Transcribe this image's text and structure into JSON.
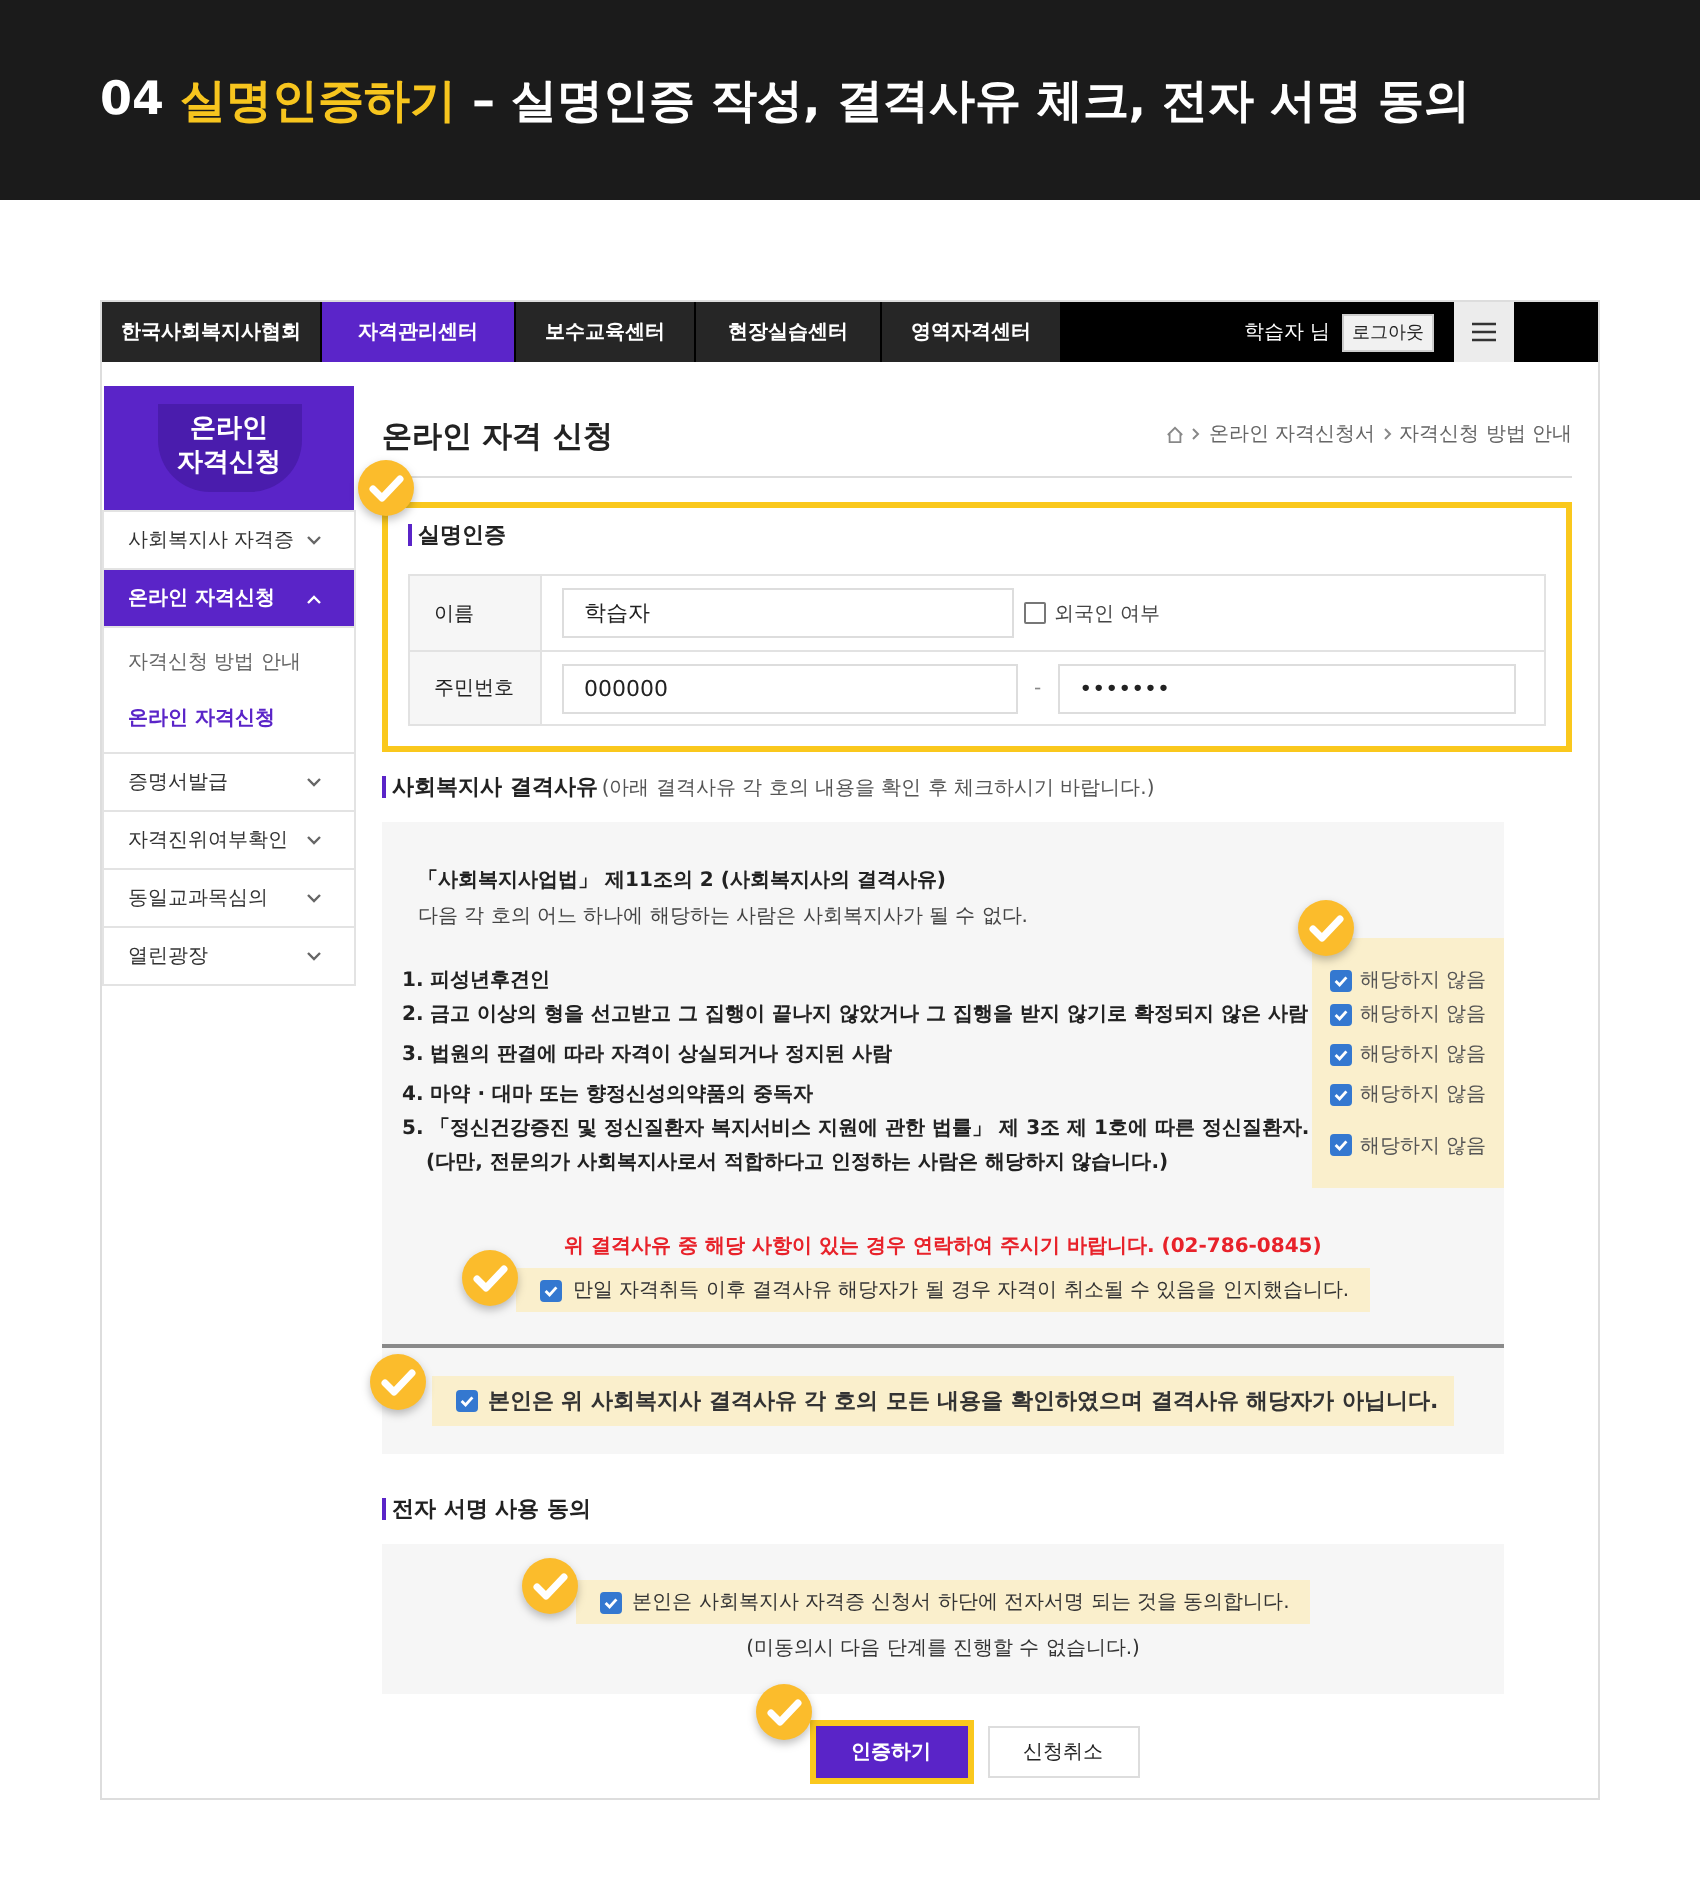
{
  "banner": {
    "number": "04",
    "highlight": "실명인증하기",
    "rest": "– 실명인증 작성, 결격사유 체크, 전자 서명 동의"
  },
  "nav": {
    "tabs": [
      {
        "label": "한국사회복지사협회",
        "selected": false
      },
      {
        "label": "자격관리센터",
        "selected": true
      },
      {
        "label": "보수교육센터",
        "selected": false
      },
      {
        "label": "현장실습센터",
        "selected": false
      },
      {
        "label": "영역자격센터",
        "selected": false
      }
    ],
    "user": "학습자 님",
    "logout": "로그아웃"
  },
  "sidebar": {
    "title": "온라인 자격신청",
    "items": [
      {
        "label": "사회복지사 자격증",
        "expanded": false
      },
      {
        "label": "온라인 자격신청",
        "expanded": true,
        "children": [
          {
            "label": "자격신청 방법 안내",
            "selected": false
          },
          {
            "label": "온라인 자격신청",
            "selected": true
          }
        ]
      },
      {
        "label": "증명서발급",
        "expanded": false
      },
      {
        "label": "자격진위여부확인",
        "expanded": false
      },
      {
        "label": "동일교과목심의",
        "expanded": false
      },
      {
        "label": "열린광장",
        "expanded": false
      }
    ]
  },
  "page": {
    "title": "온라인 자격 신청",
    "breadcrumb": [
      "온라인 자격신청서",
      "자격신청 방법 안내"
    ]
  },
  "identity": {
    "heading": "실명인증",
    "name_label": "이름",
    "name_value": "학습자",
    "foreigner": {
      "label": "외국인 여부",
      "checked": false
    },
    "id_label": "주민번호",
    "id_front": "000000",
    "id_separator": "-",
    "id_back": "•••••••"
  },
  "disqualification": {
    "heading": "사회복지사 결격사유",
    "note": "(아래 결격사유 각 호의 내용을 확인 후 체크하시기 바랍니다.)",
    "law": "「사회복지사업법」 제11조의 2 (사회복지사의 결격사유)",
    "intro": "다음 각 호의 어느 하나에 해당하는 사람은 사회복지사가 될 수 없다.",
    "items": [
      {
        "text": "1. 피성년후견인",
        "check_label": "해당하지 않음",
        "checked": true
      },
      {
        "text": "2. 금고 이상의 형을 선고받고 그 집행이 끝나지 않았거나 그 집행을 받지 않기로 확정되지 않은 사람",
        "check_label": "해당하지 않음",
        "checked": true
      },
      {
        "text": "3. 법원의 판결에 따라 자격이 상실되거나 정지된 사람",
        "check_label": "해당하지 않음",
        "checked": true
      },
      {
        "text": "4. 마약 · 대마 또는 향정신성의약품의 중독자",
        "check_label": "해당하지 않음",
        "checked": true
      },
      {
        "text": "5. 「정신건강증진 및 정신질환자 복지서비스 지원에 관한 법률」 제 3조 제 1호에 따른 정신질환자.",
        "detail": "(다만, 전문의가 사회복지사로서 적합하다고 인정하는 사람은 해당하지 않습니다.)",
        "check_label": "해당하지 않음",
        "checked": true
      }
    ],
    "contact": "위 결격사유 중 해당 사항이 있는 경우 연락하여 주시기 바랍니다. (02-786-0845)",
    "acknowledge": {
      "label": "만일 자격취득 이후 결격사유 해당자가 될 경우 자격이 취소될 수 있음을 인지했습니다.",
      "checked": true
    },
    "confirm": {
      "label": "본인은 위 사회복지사 결격사유 각 호의 모든 내용을 확인하였으며 결격사유 해당자가 아닙니다.",
      "checked": true
    }
  },
  "esign": {
    "heading": "전자 서명 사용 동의",
    "agree": {
      "label": "본인은 사회복지사 자격증 신청서 하단에 전자서명 되는 것을 동의합니다.",
      "checked": true
    },
    "note": "(미동의시 다음 단계를 진행할 수 없습니다.)"
  },
  "buttons": [
    {
      "label": "인증하기",
      "kind": "primary"
    },
    {
      "label": "신청취소",
      "kind": "secondary"
    }
  ]
}
